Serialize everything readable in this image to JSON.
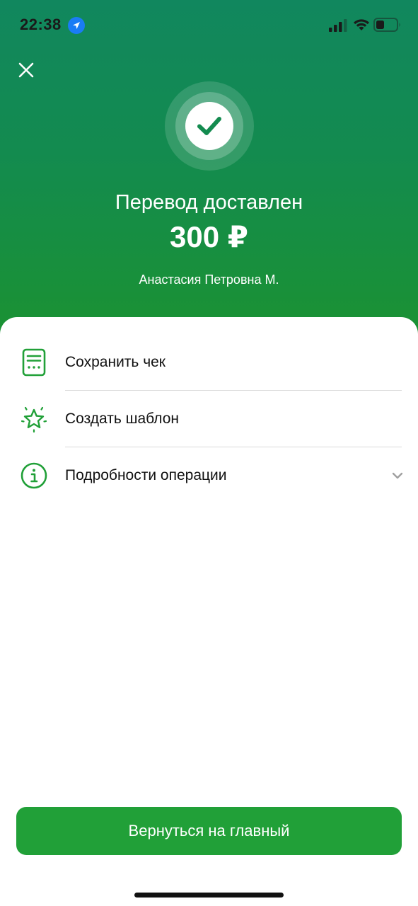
{
  "status_bar": {
    "time": "22:38",
    "icons": [
      "location-arrow-icon",
      "cellular-signal-icon",
      "wifi-icon",
      "battery-icon"
    ]
  },
  "header": {
    "close_icon": "close-icon",
    "success_icon": "checkmark-icon",
    "title": "Перевод доставлен",
    "amount": "300 ₽",
    "recipient": "Анастасия Петровна М."
  },
  "actions": [
    {
      "label": "Сохранить чек",
      "icon": "receipt-icon"
    },
    {
      "label": "Создать шаблон",
      "icon": "star-icon"
    },
    {
      "label": "Подробности операции",
      "icon": "info-icon",
      "trailing_icon": "chevron-down-icon"
    }
  ],
  "footer": {
    "primary_button_label": "Вернуться на главный"
  },
  "colors": {
    "brand_green": "#21a038",
    "hero_gradient_top": "#11875e",
    "hero_gradient_bottom": "#1b9232",
    "text_primary": "#111111",
    "divider": "#d9d9d9"
  }
}
